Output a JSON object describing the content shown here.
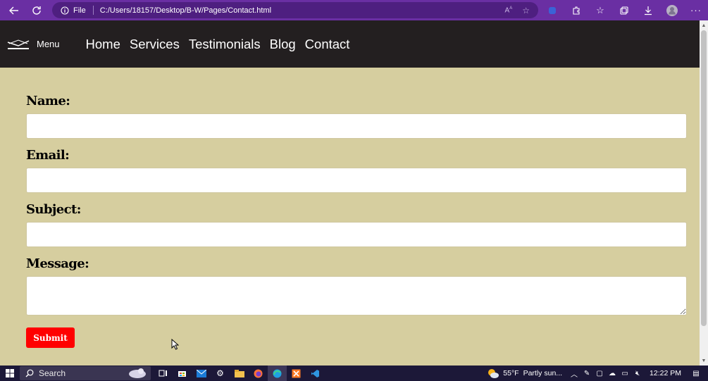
{
  "browser": {
    "scheme_label": "File",
    "url": "C:/Users/18157/Desktop/B-W/Pages/Contact.html"
  },
  "site": {
    "menu_label": "Menu",
    "nav": [
      "Home",
      "Services",
      "Testimonials",
      "Blog",
      "Contact"
    ]
  },
  "form": {
    "name_label": "Name:",
    "email_label": "Email:",
    "subject_label": "Subject:",
    "message_label": "Message:",
    "submit_label": "Submit"
  },
  "taskbar": {
    "search_label": "Search",
    "weather_temp": "55°F",
    "weather_desc": "Partly sun...",
    "time": "12:22 PM"
  },
  "colors": {
    "page_bg": "#d6ce9f",
    "header_bg": "#231f20",
    "submit_bg": "#ff0000",
    "chrome_bg": "#6a2fa3"
  }
}
